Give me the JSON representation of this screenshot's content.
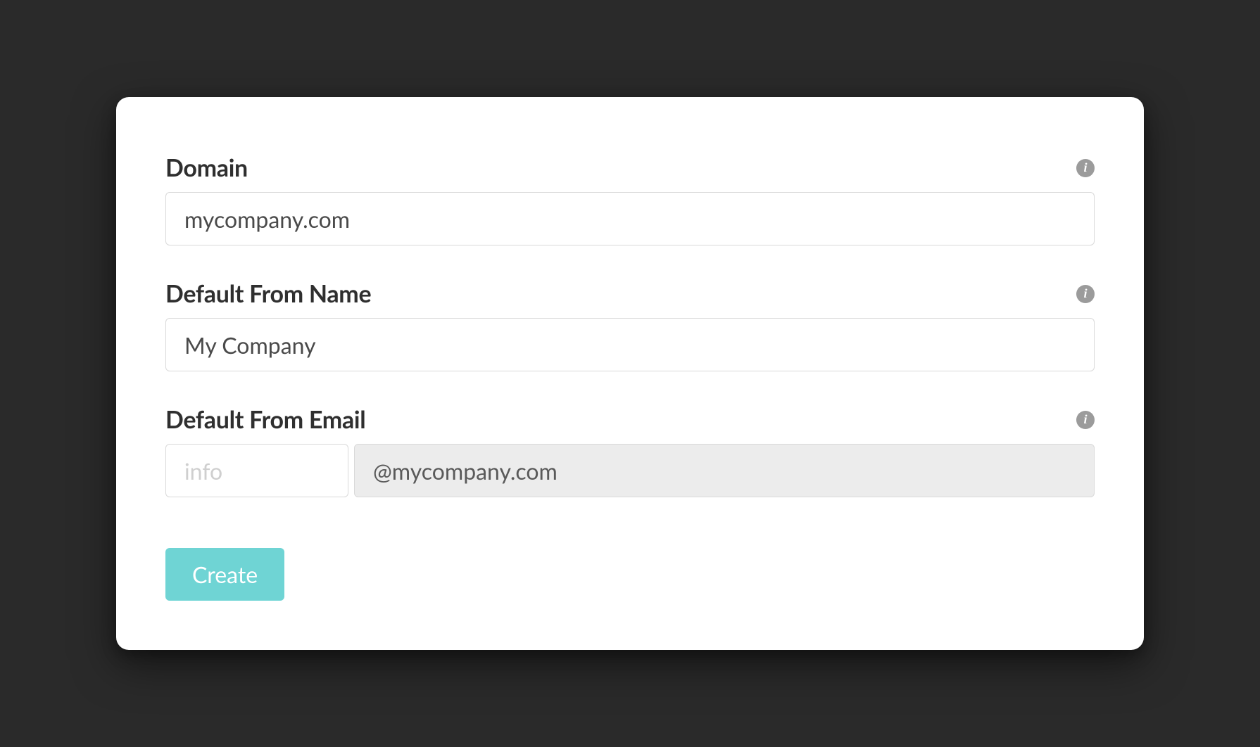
{
  "form": {
    "domain": {
      "label": "Domain",
      "value": "mycompany.com"
    },
    "from_name": {
      "label": "Default From Name",
      "value": "My Company"
    },
    "from_email": {
      "label": "Default From Email",
      "prefix_placeholder": "info",
      "suffix": "@mycompany.com"
    },
    "create_label": "Create"
  }
}
